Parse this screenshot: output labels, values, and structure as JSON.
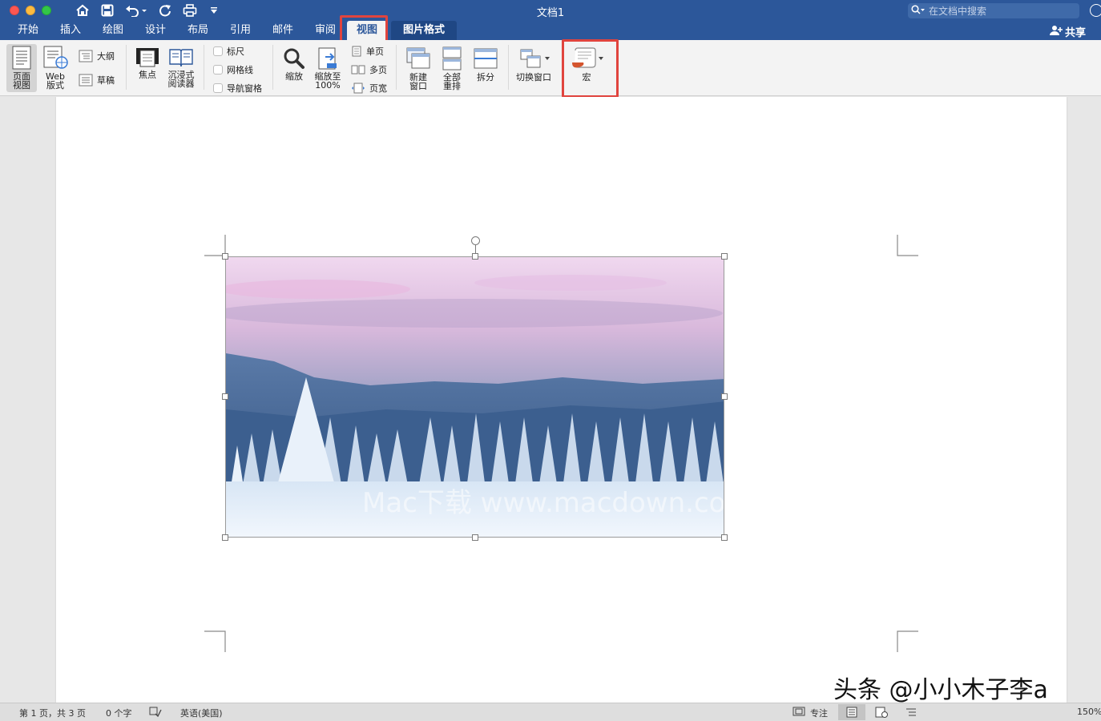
{
  "window": {
    "title": "文档1",
    "search_placeholder": "在文档中搜索"
  },
  "quick_access": [
    "home-icon",
    "save-icon",
    "undo-icon",
    "redo-icon",
    "print-icon",
    "customize-icon"
  ],
  "tabs": [
    {
      "label": "开始"
    },
    {
      "label": "插入"
    },
    {
      "label": "绘图"
    },
    {
      "label": "设计"
    },
    {
      "label": "布局"
    },
    {
      "label": "引用"
    },
    {
      "label": "邮件"
    },
    {
      "label": "审阅"
    },
    {
      "label": "视图",
      "active": true
    },
    {
      "label": "图片格式",
      "contextual": true
    }
  ],
  "share_label": "共享",
  "ribbon": {
    "page_view": "页面\n视图",
    "web_layout": "Web\n版式",
    "outline": "大纲",
    "draft": "草稿",
    "focus": "焦点",
    "immersive_reader": "沉浸式\n阅读器",
    "ruler": "标尺",
    "gridlines": "网格线",
    "nav_pane": "导航窗格",
    "zoom": "缩放",
    "zoom_100": "缩放至\n100%",
    "one_page": "单页",
    "multi_page": "多页",
    "page_width": "页宽",
    "new_window": "新建\n窗口",
    "arrange_all": "全部\n重排",
    "split": "拆分",
    "switch_window": "切换窗口",
    "macros": "宏"
  },
  "picture": {
    "watermark_text": "Mac下载  www.macdown.com"
  },
  "status": {
    "page_info": "第 1 页，共 3 页",
    "word_count": "0 个字",
    "language": "英语(美国)",
    "focus": "专注",
    "zoom": "150%"
  },
  "overlay_watermark": "头条 @小小木子李a",
  "colors": {
    "titlebar": "#2c579a",
    "highlight": "#e0443e"
  }
}
